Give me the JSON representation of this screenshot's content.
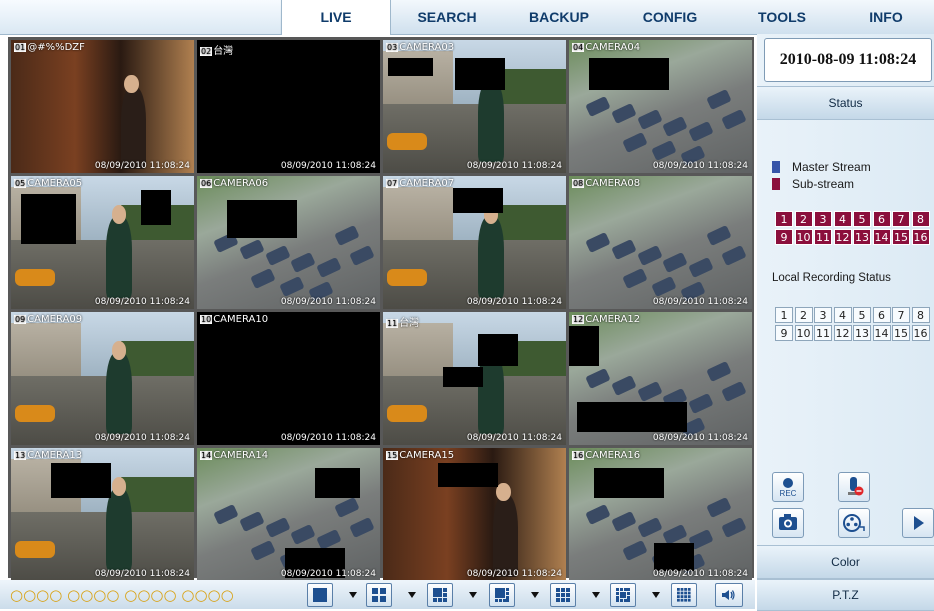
{
  "nav": {
    "tabs": [
      {
        "label": "LIVE",
        "active": true
      },
      {
        "label": "SEARCH"
      },
      {
        "label": "BACKUP"
      },
      {
        "label": "CONFIG"
      },
      {
        "label": "TOOLS"
      },
      {
        "label": "INFO"
      }
    ]
  },
  "cameras": [
    {
      "num": "01",
      "name": "@#%%DZF",
      "ts": "08/09/2010 11:08:24",
      "scene": "indoor",
      "selected": true
    },
    {
      "num": "02",
      "name": "台灣",
      "ts": "08/09/2010 11:08:24",
      "scene": "black"
    },
    {
      "num": "03",
      "name": "CAMERA03",
      "ts": "08/09/2010 11:08:24",
      "scene": "street"
    },
    {
      "num": "04",
      "name": "CAMERA04",
      "ts": "08/09/2010 11:08:24",
      "scene": "lot"
    },
    {
      "num": "05",
      "name": "CAMERA05",
      "ts": "08/09/2010 11:08:24",
      "scene": "street"
    },
    {
      "num": "06",
      "name": "CAMERA06",
      "ts": "08/09/2010 11:08:24",
      "scene": "lot"
    },
    {
      "num": "07",
      "name": "CAMERA07",
      "ts": "08/09/2010 11:08:24",
      "scene": "street"
    },
    {
      "num": "08",
      "name": "CAMERA08",
      "ts": "08/09/2010 11:08:24",
      "scene": "lot"
    },
    {
      "num": "09",
      "name": "CAMERA09",
      "ts": "08/09/2010 11:08:24",
      "scene": "street"
    },
    {
      "num": "10",
      "name": "CAMERA10",
      "ts": "08/09/2010 11:08:24",
      "scene": "black"
    },
    {
      "num": "11",
      "name": "台灣",
      "ts": "08/09/2010 11:08:24",
      "scene": "street"
    },
    {
      "num": "12",
      "name": "CAMERA12",
      "ts": "08/09/2010 11:08:24",
      "scene": "lot"
    },
    {
      "num": "13",
      "name": "CAMERA13",
      "ts": "08/09/2010 11:08:24",
      "scene": "street"
    },
    {
      "num": "14",
      "name": "CAMERA14",
      "ts": "08/09/2010 11:08:24",
      "scene": "lot"
    },
    {
      "num": "15",
      "name": "CAMERA15",
      "ts": "08/09/2010 11:08:24",
      "scene": "indoor"
    },
    {
      "num": "16",
      "name": "CAMERA16",
      "ts": "08/09/2010 11:08:24",
      "scene": "lot"
    }
  ],
  "bottom": {
    "indicators": "○○○○ ○○○○ ○○○○ ○○○○",
    "layouts": [
      {
        "icon": "layout-1-icon"
      },
      {
        "icon": "layout-4-icon"
      },
      {
        "icon": "layout-6-icon"
      },
      {
        "icon": "layout-8-icon"
      },
      {
        "icon": "layout-9-icon"
      },
      {
        "icon": "layout-13-icon"
      },
      {
        "icon": "layout-16-icon"
      }
    ],
    "audio_icon": "speaker-icon"
  },
  "panel": {
    "datetime": "2010-08-09 11:08:24",
    "status_label": "Status",
    "master_stream": "Master Stream",
    "sub_stream": "Sub-stream",
    "master_color": "#3654a8",
    "sub_color": "#8b0f3c",
    "channels": [
      "1",
      "2",
      "3",
      "4",
      "5",
      "6",
      "7",
      "8",
      "9",
      "10",
      "11",
      "12",
      "13",
      "14",
      "15",
      "16"
    ],
    "local_recording": "Local Recording Status",
    "rec_label": "REC",
    "color_label": "Color",
    "ptz_label": "P.T.Z"
  }
}
